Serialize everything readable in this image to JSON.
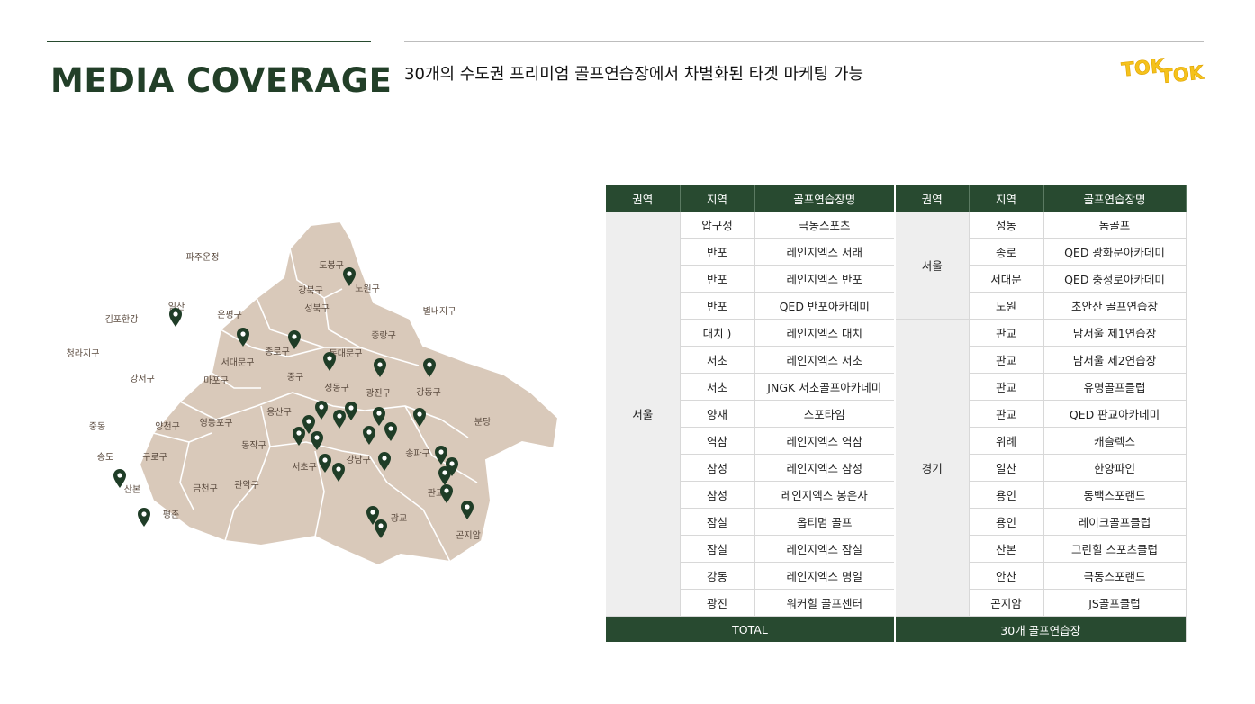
{
  "header": {
    "title": "MEDIA COVERAGE",
    "subtitle": "30개의 수도권 프리미엄 골프연습장에서 차별화된 타겟 마케팅 가능",
    "logo_text": "TOK TOK"
  },
  "colors": {
    "brand_green": "#284a30",
    "map_fill": "#d9c9ba",
    "pin": "#1f3d27",
    "logo_yellow": "#f5c21b"
  },
  "map": {
    "districts": [
      "도봉구",
      "노원구",
      "강북구",
      "은평구",
      "성북구",
      "중랑구",
      "종로구",
      "동대문구",
      "서대문구",
      "중구",
      "마포구",
      "성동구",
      "광진구",
      "강동구",
      "강서구",
      "용산구",
      "양천구",
      "영등포구",
      "동작구",
      "서초구",
      "강남구",
      "송파구",
      "구로구",
      "금천구",
      "관악구"
    ],
    "outside": [
      "파주운정",
      "일산",
      "김포한강",
      "청라지구",
      "별내지구",
      "중동",
      "송도",
      "산본",
      "평촌",
      "분당",
      "판교",
      "광교",
      "곤지암"
    ]
  },
  "table": {
    "headers": [
      "권역",
      "지역",
      "골프연습장명",
      "권역",
      "지역",
      "골프연습장명"
    ],
    "left_region": "서울",
    "right_regions": [
      "서울",
      "경기"
    ],
    "rows": [
      {
        "area": "압구정",
        "name": "극동스포츠",
        "area2": "성동",
        "name2": "돔골프"
      },
      {
        "area": "반포",
        "name": "레인지엑스 서래",
        "area2": "종로",
        "name2": "QED 광화문아카데미"
      },
      {
        "area": "반포",
        "name": "레인지엑스 반포",
        "area2": "서대문",
        "name2": "QED 충정로아카데미"
      },
      {
        "area": "반포",
        "name": "QED 반포아카데미",
        "area2": "노원",
        "name2": "초안산 골프연습장"
      },
      {
        "area": "대치 )",
        "name": "레인지엑스 대치",
        "area2": "판교",
        "name2": "남서울 제1연습장"
      },
      {
        "area": "서초",
        "name": "레인지엑스 서초",
        "area2": "판교",
        "name2": "남서울 제2연습장"
      },
      {
        "area": "서초",
        "name": "JNGK 서초골프아카데미",
        "area2": "판교",
        "name2": "유명골프클럽"
      },
      {
        "area": "양재",
        "name": "스포타임",
        "area2": "판교",
        "name2": "QED 판교아카데미"
      },
      {
        "area": "역삼",
        "name": "레인지엑스 역삼",
        "area2": "위례",
        "name2": "캐슬렉스"
      },
      {
        "area": "삼성",
        "name": "레인지엑스 삼성",
        "area2": "일산",
        "name2": "한양파인"
      },
      {
        "area": "삼성",
        "name": "레인지엑스 봉은사",
        "area2": "용인",
        "name2": "동백스포랜드"
      },
      {
        "area": "잠실",
        "name": "옵티멈 골프",
        "area2": "용인",
        "name2": "레이크골프클럽"
      },
      {
        "area": "잠실",
        "name": "레인지엑스 잠실",
        "area2": "산본",
        "name2": "그린힐 스포츠클럽"
      },
      {
        "area": "강동",
        "name": "레인지엑스 명일",
        "area2": "안산",
        "name2": "극동스포랜드"
      },
      {
        "area": "광진",
        "name": "워커힐 골프센터",
        "area2": "곤지암",
        "name2": "JS골프클럽"
      }
    ],
    "total_label": "TOTAL",
    "total_value": "30개 골프연습장"
  }
}
